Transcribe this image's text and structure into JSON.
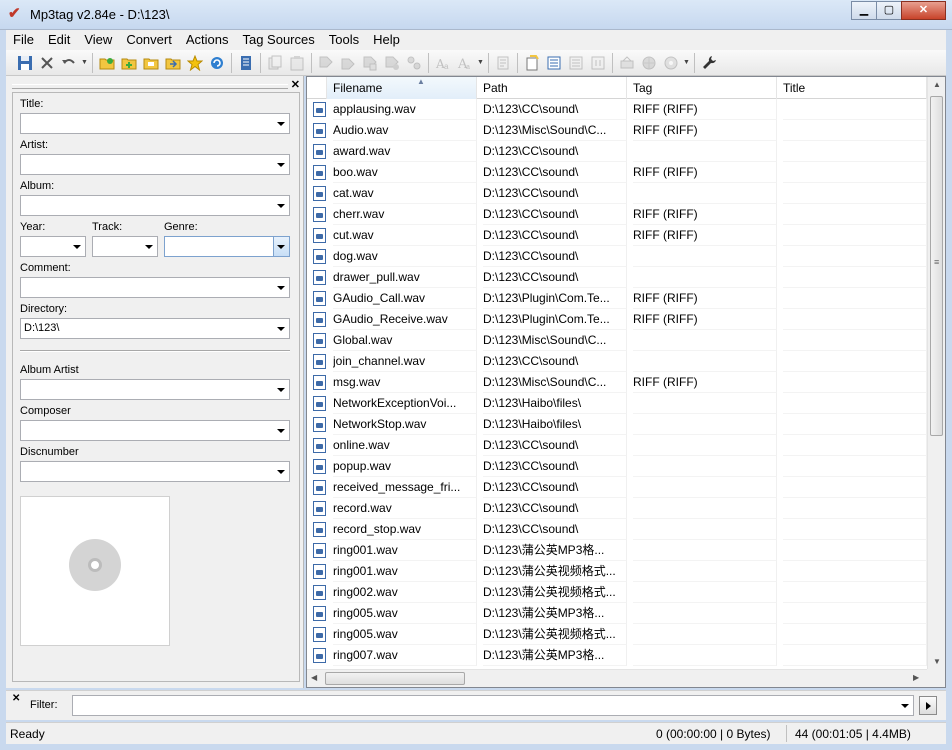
{
  "window": {
    "title": "Mp3tag v2.84e  -  D:\\123\\"
  },
  "menu": [
    "File",
    "Edit",
    "View",
    "Convert",
    "Actions",
    "Tag Sources",
    "Tools",
    "Help"
  ],
  "toolbar": {
    "icons": [
      "save-icon",
      "remove-tag-icon",
      "undo-icon",
      "change-directory-icon",
      "add-directory-icon",
      "open-playlist-icon",
      "save-playlist-icon",
      "favorite-icon",
      "refresh-icon",
      "extended-tags-icon",
      "copy-tag-icon",
      "paste-tag-icon",
      "tag-to-filename-icon",
      "filename-to-tag-icon",
      "text-to-tag-icon",
      "tag-to-tag-icon",
      "case-conversion-icon",
      "actions-icon",
      "playlist-icon",
      "export-icon",
      "autonumbering-icon",
      "tag-sources-freedb-icon",
      "tag-sources-web-icon",
      "options-icon"
    ]
  },
  "editor": {
    "title_label": "Title:",
    "title_value": "",
    "artist_label": "Artist:",
    "artist_value": "",
    "album_label": "Album:",
    "album_value": "",
    "year_label": "Year:",
    "year_value": "",
    "track_label": "Track:",
    "track_value": "",
    "genre_label": "Genre:",
    "genre_value": "",
    "comment_label": "Comment:",
    "comment_value": "",
    "directory_label": "Directory:",
    "directory_value": "D:\\123\\",
    "album_artist_label": "Album Artist",
    "album_artist_value": "",
    "composer_label": "Composer",
    "composer_value": "",
    "discnumber_label": "Discnumber",
    "discnumber_value": ""
  },
  "list": {
    "columns": [
      "Filename",
      "Path",
      "Tag",
      "Title"
    ],
    "sorted_column": "Filename",
    "rows": [
      {
        "filename": "applausing.wav",
        "path": "D:\\123\\CC\\sound\\",
        "tag": "RIFF (RIFF)",
        "title": ""
      },
      {
        "filename": "Audio.wav",
        "path": "D:\\123\\Misc\\Sound\\C...",
        "tag": "RIFF (RIFF)",
        "title": ""
      },
      {
        "filename": "award.wav",
        "path": "D:\\123\\CC\\sound\\",
        "tag": "",
        "title": ""
      },
      {
        "filename": "boo.wav",
        "path": "D:\\123\\CC\\sound\\",
        "tag": "RIFF (RIFF)",
        "title": ""
      },
      {
        "filename": "cat.wav",
        "path": "D:\\123\\CC\\sound\\",
        "tag": "",
        "title": ""
      },
      {
        "filename": "cherr.wav",
        "path": "D:\\123\\CC\\sound\\",
        "tag": "RIFF (RIFF)",
        "title": ""
      },
      {
        "filename": "cut.wav",
        "path": "D:\\123\\CC\\sound\\",
        "tag": "RIFF (RIFF)",
        "title": ""
      },
      {
        "filename": "dog.wav",
        "path": "D:\\123\\CC\\sound\\",
        "tag": "",
        "title": ""
      },
      {
        "filename": "drawer_pull.wav",
        "path": "D:\\123\\CC\\sound\\",
        "tag": "",
        "title": ""
      },
      {
        "filename": "GAudio_Call.wav",
        "path": "D:\\123\\Plugin\\Com.Te...",
        "tag": "RIFF (RIFF)",
        "title": ""
      },
      {
        "filename": "GAudio_Receive.wav",
        "path": "D:\\123\\Plugin\\Com.Te...",
        "tag": "RIFF (RIFF)",
        "title": ""
      },
      {
        "filename": "Global.wav",
        "path": "D:\\123\\Misc\\Sound\\C...",
        "tag": "",
        "title": ""
      },
      {
        "filename": "join_channel.wav",
        "path": "D:\\123\\CC\\sound\\",
        "tag": "",
        "title": ""
      },
      {
        "filename": "msg.wav",
        "path": "D:\\123\\Misc\\Sound\\C...",
        "tag": "RIFF (RIFF)",
        "title": ""
      },
      {
        "filename": "NetworkExceptionVoi...",
        "path": "D:\\123\\Haibo\\files\\",
        "tag": "",
        "title": ""
      },
      {
        "filename": "NetworkStop.wav",
        "path": "D:\\123\\Haibo\\files\\",
        "tag": "",
        "title": ""
      },
      {
        "filename": "online.wav",
        "path": "D:\\123\\CC\\sound\\",
        "tag": "",
        "title": ""
      },
      {
        "filename": "popup.wav",
        "path": "D:\\123\\CC\\sound\\",
        "tag": "",
        "title": ""
      },
      {
        "filename": "received_message_fri...",
        "path": "D:\\123\\CC\\sound\\",
        "tag": "",
        "title": ""
      },
      {
        "filename": "record.wav",
        "path": "D:\\123\\CC\\sound\\",
        "tag": "",
        "title": ""
      },
      {
        "filename": "record_stop.wav",
        "path": "D:\\123\\CC\\sound\\",
        "tag": "",
        "title": ""
      },
      {
        "filename": "ring001.wav",
        "path": "D:\\123\\蒲公英MP3格...",
        "tag": "",
        "title": ""
      },
      {
        "filename": "ring001.wav",
        "path": "D:\\123\\蒲公英视频格式...",
        "tag": "",
        "title": ""
      },
      {
        "filename": "ring002.wav",
        "path": "D:\\123\\蒲公英视频格式...",
        "tag": "",
        "title": ""
      },
      {
        "filename": "ring005.wav",
        "path": "D:\\123\\蒲公英MP3格...",
        "tag": "",
        "title": ""
      },
      {
        "filename": "ring005.wav",
        "path": "D:\\123\\蒲公英视频格式...",
        "tag": "",
        "title": ""
      },
      {
        "filename": "ring007.wav",
        "path": "D:\\123\\蒲公英MP3格...",
        "tag": "",
        "title": ""
      }
    ]
  },
  "filter": {
    "label": "Filter:",
    "value": ""
  },
  "status": {
    "left": "Ready",
    "selected": "0 (00:00:00 | 0 Bytes)",
    "total": "44 (00:01:05 | 4.4MB)"
  },
  "colors": {
    "titlebar": "#c6d8ef",
    "close_button": "#c8432a",
    "file_icon": "#3d6aa8"
  }
}
